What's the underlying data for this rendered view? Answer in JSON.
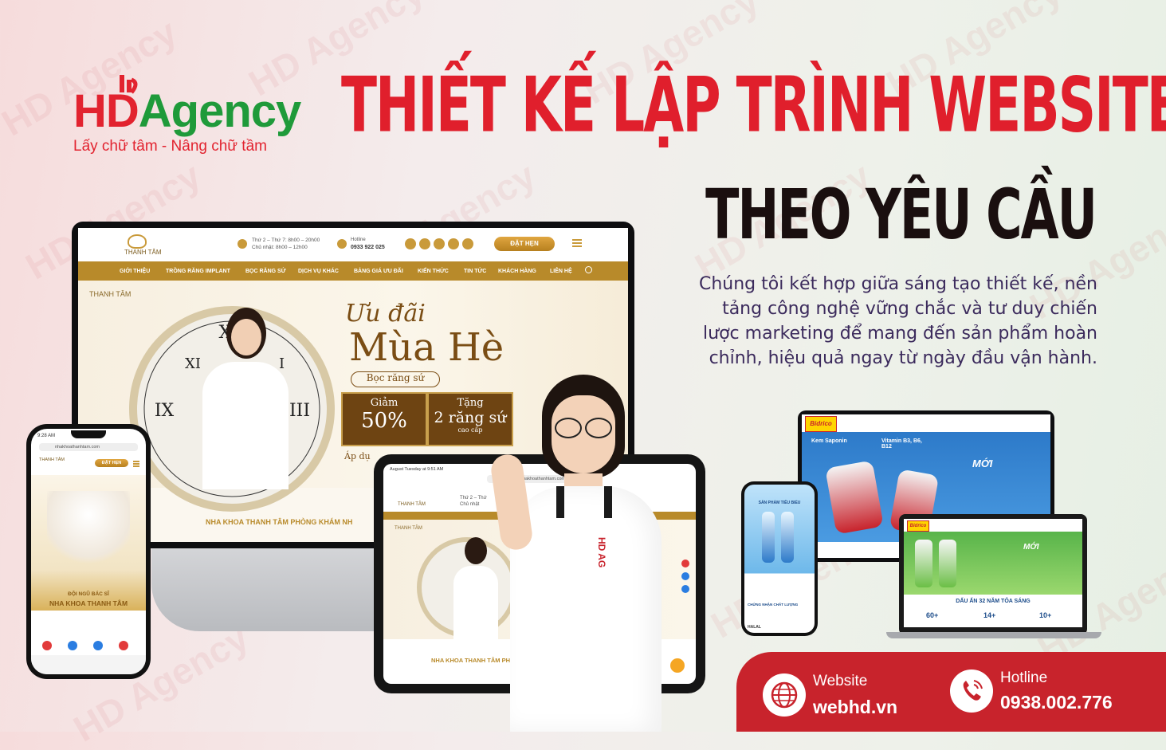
{
  "brand": {
    "logo_hd": "HD",
    "logo_agency": "Agency",
    "tagline": "Lấy chữ tâm - Nâng chữ tầm",
    "color_red": "#e2232f",
    "color_green": "#1f9a3a"
  },
  "headline": {
    "line1": "THIẾT KẾ LẬP TRÌNH WEBSITE",
    "line2": "THEO YÊU CẦU"
  },
  "description": {
    "lines": [
      "Chúng tôi kết hợp giữa sáng tạo thiết kế, nền",
      "tảng công nghệ vững chắc và tư duy chiến",
      "lược marketing để mang đến sản phẩm hoàn",
      "chỉnh, hiệu quả ngay từ ngày đầu vận hành."
    ]
  },
  "desktop_site": {
    "brand": "THANH TÂM",
    "hours_1": "Thứ 2 – Thứ 7: 8h00 – 20h00",
    "hours_2": "Chủ nhật: 8h00 – 12h00",
    "hotline_label": "Hotline",
    "hotline": "0933 922 025",
    "book_button": "ĐẶT HẸN",
    "nav": [
      "GIỚI THIỆU",
      "TRỒNG RĂNG IMPLANT",
      "BỌC RĂNG SỨ",
      "DỊCH VỤ KHÁC",
      "BẢNG GIÁ ƯU ĐÃI",
      "KIẾN THỨC",
      "TIN TỨC",
      "KHÁCH HÀNG",
      "LIÊN HỆ"
    ],
    "promo_script": "Ưu đãi",
    "promo_title": "Mùa Hè",
    "promo_sub": "Bọc răng sứ",
    "offer1_label": "Giảm",
    "offer1_value": "50%",
    "offer2_label": "Tặng",
    "offer2_value": "2 răng sứ",
    "offer2_note": "cao cấp",
    "apply_note": "Áp dụ",
    "section_title": "NHA KHOA THANH TÂM PHÒNG KHÁM NH"
  },
  "phone_site": {
    "time": "9:28 AM",
    "url": "nhakhoathanhtam.com",
    "brand": "THANH TÂM",
    "book_button": "ĐẶT HẸN",
    "caption_1": "ĐỘI NGŨ BÁC SĨ",
    "caption_2": "NHA KHOA THANH TÂM"
  },
  "tablet_site": {
    "status": "August Tuesday at 9:51 AM",
    "url": "nhakhoathanhtam.com",
    "brand": "THANH TÂM",
    "hours": "Thứ 2 – Thứ",
    "hours_2": "Chủ nhật",
    "section_title": "NHA KHOA THANH TÂM PH"
  },
  "bidrico_site": {
    "brand": "Bidrico",
    "product1": "Kem Saponin",
    "product2": "Vitamin B3, B6, B12",
    "tag_new": "MỚI",
    "footer_text": "DẤU ẤN 32 NĂM TỎA SÁNG",
    "stats": [
      "60+",
      "14+",
      "10+"
    ],
    "phone_title": "SẢN PHẨM TIÊU BIỂU",
    "phone_cert": "CHỨNG NHẬN CHẤT LƯỢNG",
    "phone_halal": "HALAL"
  },
  "shirt_logo": "HD AG",
  "contact": {
    "website_label": "Website",
    "website": "webhd.vn",
    "hotline_label": "Hotline",
    "hotline": "0938.002.776"
  }
}
